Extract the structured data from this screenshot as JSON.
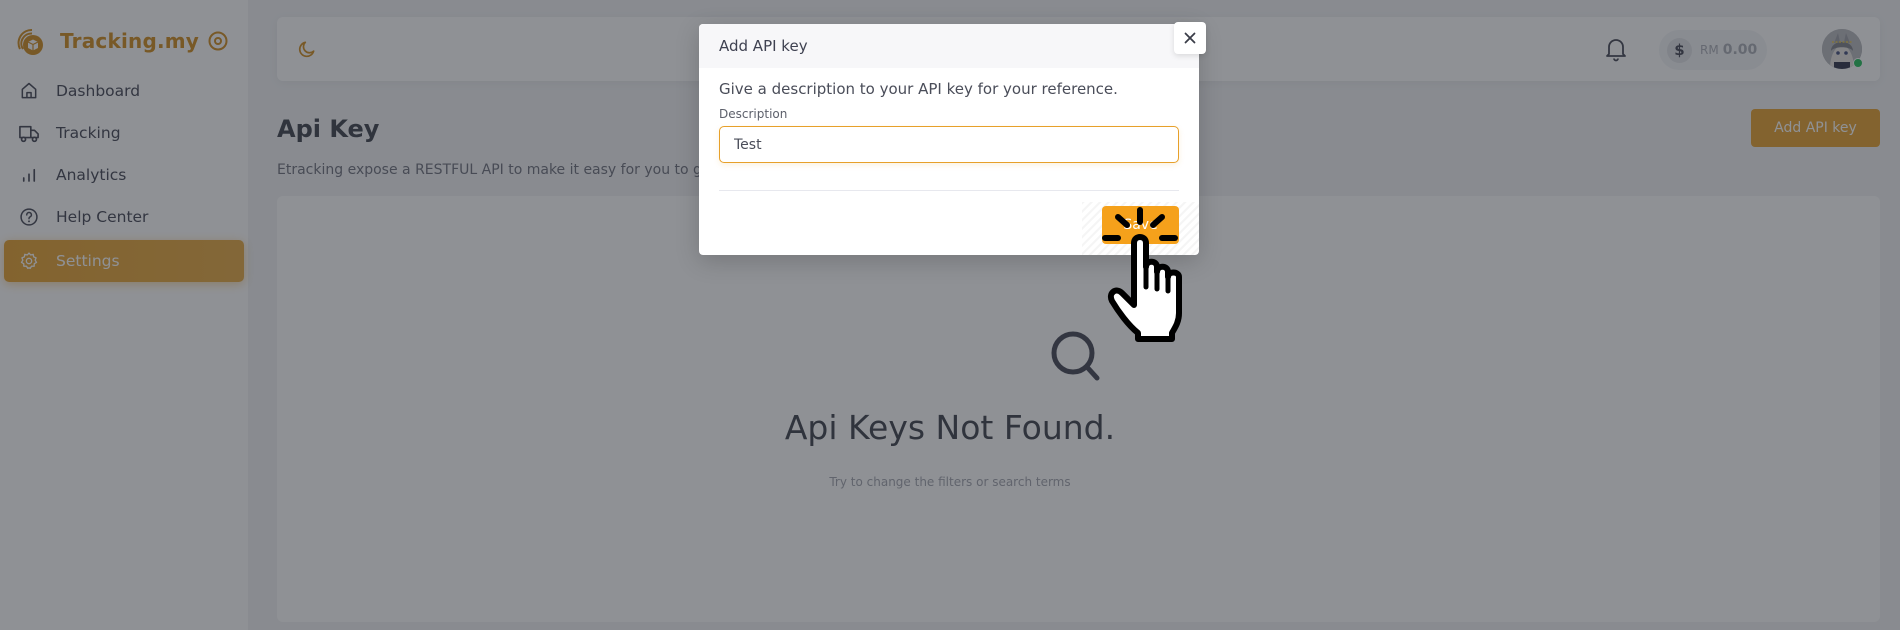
{
  "app": {
    "brand_name": "Tracking.my",
    "colors": {
      "accent": "#e7a02a",
      "accent_bright": "#f5a11b",
      "brand_text": "#d08a1a",
      "online_status": "#1fbf57"
    }
  },
  "sidebar": {
    "items": [
      {
        "label": "Dashboard",
        "icon": "home-icon",
        "active": false
      },
      {
        "label": "Tracking",
        "icon": "truck-icon",
        "active": false
      },
      {
        "label": "Analytics",
        "icon": "bar-chart-icon",
        "active": false
      },
      {
        "label": "Help Center",
        "icon": "help-circle-icon",
        "active": false
      },
      {
        "label": "Settings",
        "icon": "gear-icon",
        "active": true
      }
    ]
  },
  "header": {
    "theme_icon": "moon-icon",
    "notification_icon": "bell-icon",
    "wallet": {
      "currency": "RM",
      "amount": "0.00",
      "icon": "dollar-icon"
    },
    "user_status": "online"
  },
  "page": {
    "title": "Api Key",
    "description": "Etracking expose a RESTFUL API to make it easy for you to g",
    "add_button_label": "Add API key",
    "empty_state": {
      "icon": "search-icon",
      "title": "Api Keys Not Found.",
      "subtitle": "Try to change the filters or search terms"
    }
  },
  "modal": {
    "title": "Add API key",
    "close_icon": "close-icon",
    "lead": "Give a description to your API key for your reference.",
    "field_label": "Description",
    "field_value": "Test",
    "save_label": "Save"
  },
  "cursor": {
    "type": "hand-pointer-click-icon"
  }
}
